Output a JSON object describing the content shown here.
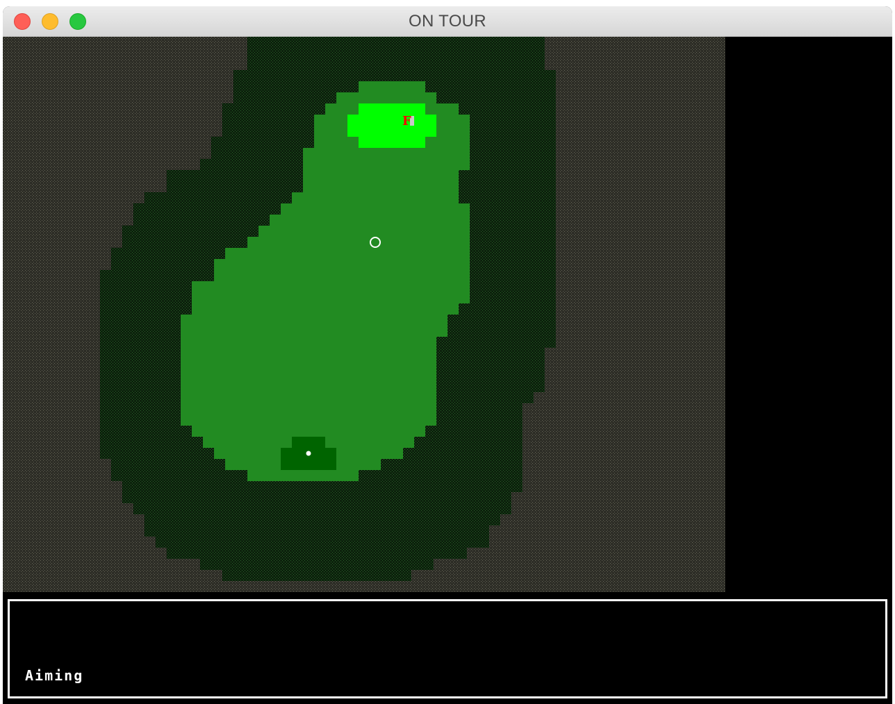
{
  "window": {
    "title": "ON TOUR"
  },
  "hole": {
    "flag_letter": "F",
    "colors": {
      "rough_texture": "#6b6b5a",
      "deep_rough": "#123812",
      "fairway": "#228b22",
      "green": "#00ff00",
      "tee_box": "#006400",
      "flag": "#ff0000",
      "ball": "#ffffff",
      "aim_marker": "#ffffff"
    }
  },
  "status": {
    "text": "Aiming"
  }
}
